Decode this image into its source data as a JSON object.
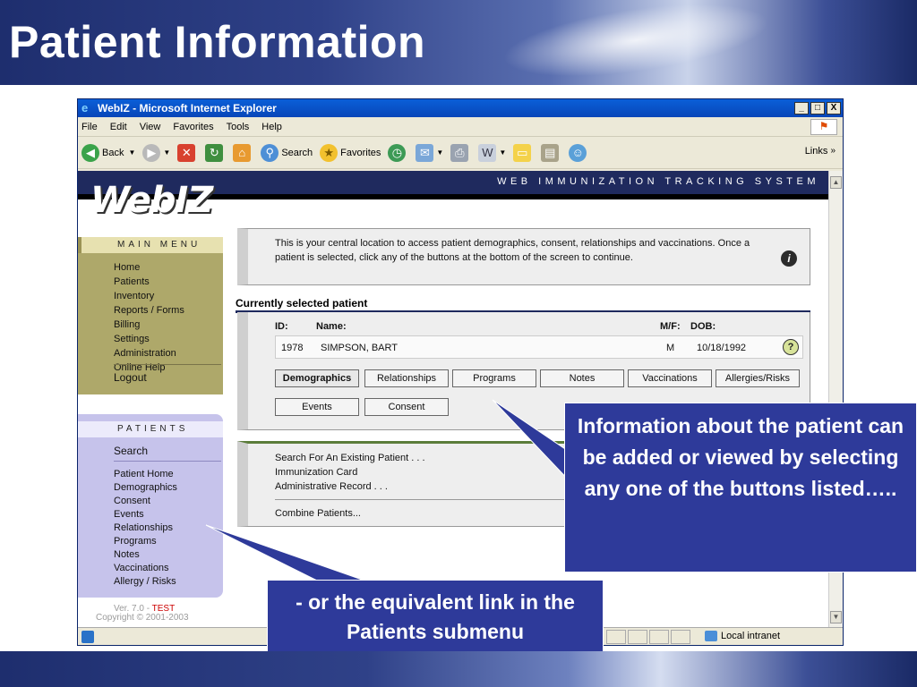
{
  "slide": {
    "title": "Patient Information"
  },
  "browser": {
    "title": "WebIZ - Microsoft Internet Explorer",
    "window_buttons": [
      "_",
      "□",
      "X"
    ],
    "menu": [
      "File",
      "Edit",
      "View",
      "Favorites",
      "Tools",
      "Help"
    ],
    "toolbar": {
      "back": "Back",
      "search": "Search",
      "favorites": "Favorites",
      "links": "Links"
    },
    "status": {
      "zone": "Local intranet"
    }
  },
  "app": {
    "logo": "WebIZ",
    "subtitle": "WEB IMMUNIZATION TRACKING SYSTEM",
    "main_menu": {
      "title": "MAIN MENU",
      "items": [
        "Home",
        "Patients",
        "Inventory",
        "Reports / Forms",
        "Billing",
        "Settings",
        "Administration",
        "Online Help"
      ],
      "logout": "Logout"
    },
    "patients_menu": {
      "title": "PATIENTS",
      "search": "Search",
      "items": [
        "Patient Home",
        "Demographics",
        "Consent",
        "Events",
        "Relationships",
        "Programs",
        "Notes",
        "Vaccinations",
        "Allergy / Risks"
      ]
    },
    "version_prefix": "Ver. 7.0 -",
    "version_env": "TEST",
    "copyright": "Copyright © 2001-2003",
    "info_text": "This is your central location to access patient demographics, consent, relationships and vaccinations. Once a patient is selected, click any of the buttons at the bottom of the screen to continue.",
    "current_patient_label": "Currently selected patient",
    "patient_columns": {
      "id": "ID:",
      "name": "Name:",
      "mf": "M/F:",
      "dob": "DOB:"
    },
    "patient": {
      "id": "1978",
      "name": "SIMPSON, BART",
      "sex": "M",
      "dob": "10/18/1992"
    },
    "buttons_row1": [
      "Demographics",
      "Relationships",
      "Programs",
      "Notes",
      "Vaccinations",
      "Allergies/Risks"
    ],
    "buttons_row2": [
      "Events",
      "Consent"
    ],
    "search_links": [
      "Search For An Existing Patient . . .",
      "Immunization Card",
      "Administrative Record . . ."
    ],
    "combine": "Combine Patients..."
  },
  "callouts": {
    "right": "Information about the patient can be added or viewed by selecting any one of the buttons listed…..",
    "bottom": "- or the equivalent link in the Patients submenu"
  },
  "colors": {
    "callout_bg": "#2e3a9a",
    "header_navy": "#1f2a5e",
    "main_menu_olive": "#aea86a",
    "patients_menu_lavender": "#c6c3eb"
  }
}
